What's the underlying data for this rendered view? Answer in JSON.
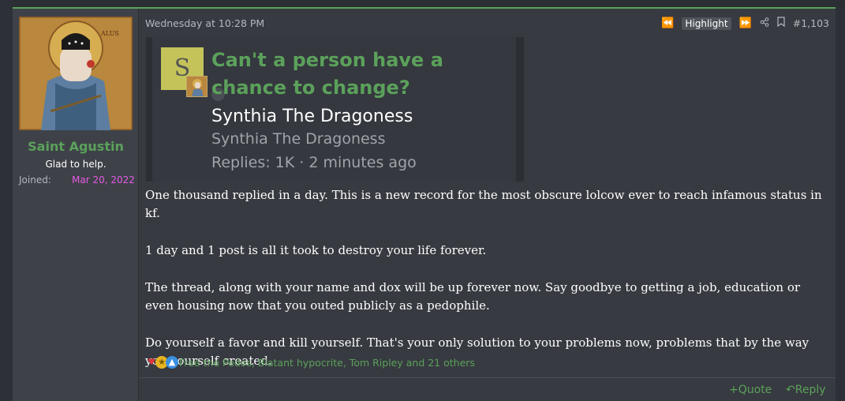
{
  "user": {
    "name": "Saint Agustin",
    "title": "Glad to help.",
    "joined_label": "Joined:",
    "joined_date": "Mar 20, 2022"
  },
  "post": {
    "date": "Wednesday at 10:28 PM",
    "highlight_label": "Highlight",
    "post_number": "#1,103"
  },
  "embed": {
    "avatar_letter": "S",
    "title": "Can't a person have a chance to change?",
    "name": "Synthia The Dragoness",
    "sub": "Synthia The Dragoness",
    "meta": "Replies: 1K · 2 minutes ago"
  },
  "body": {
    "p1": "One thousand replied in a day. This is a new record for the most obscure lolcow ever to reach infamous status in kf.",
    "p2": "1 day and 1 post is all it took to destroy your life forever.",
    "p3": "The thread, along with your name and dox will be up forever now. Say goodbye to getting a job, education or even housing now that you outed publicly as a pedophile.",
    "p4": "Do yourself a favor and kill yourself. That's your only solution to your problems now, problems that by the way you yourself created."
  },
  "reactions": {
    "text": "Free the Pedos, Blatant hypocrite, Tom Ripley and 21 others",
    "icons": [
      "heart-icon",
      "winner-icon",
      "thumbs-up-icon"
    ]
  },
  "footer": {
    "quote_label": "Quote",
    "reply_label": "Reply"
  },
  "colors": {
    "accent": "#5ba15b",
    "joined_date": "#e558e5"
  }
}
